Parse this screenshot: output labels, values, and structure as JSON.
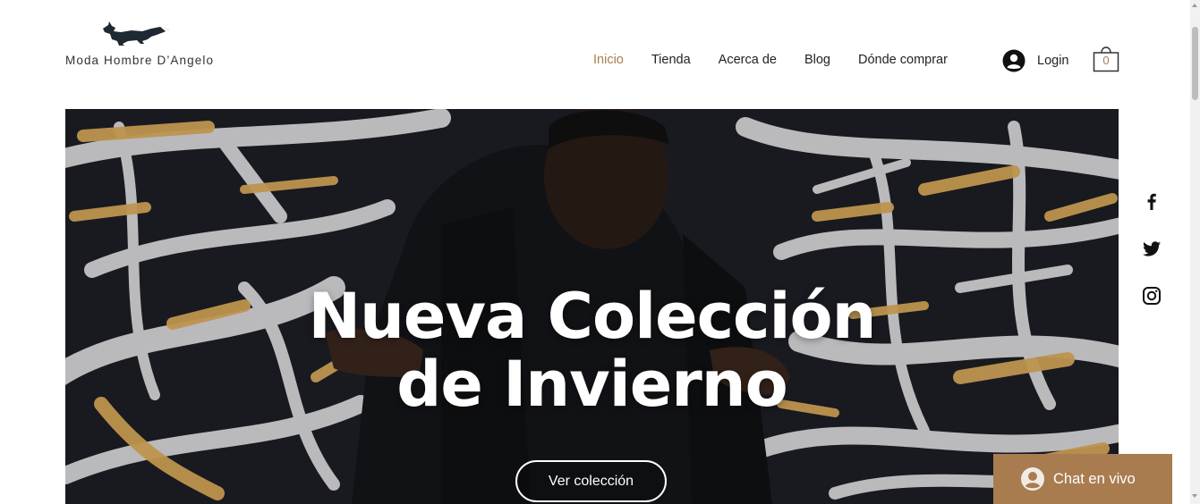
{
  "brand": {
    "name": "Moda Hombre D’Angelo",
    "logo_icon": "fox-logo-icon"
  },
  "nav": {
    "items": [
      {
        "label": "Inicio",
        "active": true
      },
      {
        "label": "Tienda",
        "active": false
      },
      {
        "label": "Acerca de",
        "active": false
      },
      {
        "label": "Blog",
        "active": false
      },
      {
        "label": "Dónde comprar",
        "active": false
      }
    ]
  },
  "account": {
    "login_label": "Login",
    "icon": "user-avatar-icon"
  },
  "cart": {
    "count": "0",
    "icon": "shopping-bag-icon"
  },
  "hero": {
    "title_line1": "Nueva Colección",
    "title_line2": "de Invierno",
    "button_label": "Ver colección"
  },
  "social": {
    "icons": [
      "facebook-icon",
      "twitter-icon",
      "instagram-icon"
    ]
  },
  "chat": {
    "label": "Chat en vivo",
    "icon": "chat-avatar-icon"
  },
  "colors": {
    "accent": "#a97c50",
    "text": "#222222",
    "background": "#ffffff"
  }
}
